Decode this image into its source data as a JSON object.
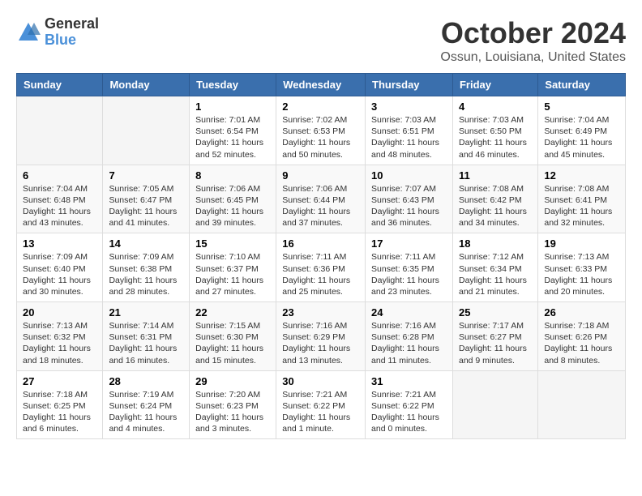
{
  "logo": {
    "general": "General",
    "blue": "Blue"
  },
  "title": "October 2024",
  "location": "Ossun, Louisiana, United States",
  "days_of_week": [
    "Sunday",
    "Monday",
    "Tuesday",
    "Wednesday",
    "Thursday",
    "Friday",
    "Saturday"
  ],
  "weeks": [
    [
      {
        "day": "",
        "info": ""
      },
      {
        "day": "",
        "info": ""
      },
      {
        "day": "1",
        "info": "Sunrise: 7:01 AM\nSunset: 6:54 PM\nDaylight: 11 hours and 52 minutes."
      },
      {
        "day": "2",
        "info": "Sunrise: 7:02 AM\nSunset: 6:53 PM\nDaylight: 11 hours and 50 minutes."
      },
      {
        "day": "3",
        "info": "Sunrise: 7:03 AM\nSunset: 6:51 PM\nDaylight: 11 hours and 48 minutes."
      },
      {
        "day": "4",
        "info": "Sunrise: 7:03 AM\nSunset: 6:50 PM\nDaylight: 11 hours and 46 minutes."
      },
      {
        "day": "5",
        "info": "Sunrise: 7:04 AM\nSunset: 6:49 PM\nDaylight: 11 hours and 45 minutes."
      }
    ],
    [
      {
        "day": "6",
        "info": "Sunrise: 7:04 AM\nSunset: 6:48 PM\nDaylight: 11 hours and 43 minutes."
      },
      {
        "day": "7",
        "info": "Sunrise: 7:05 AM\nSunset: 6:47 PM\nDaylight: 11 hours and 41 minutes."
      },
      {
        "day": "8",
        "info": "Sunrise: 7:06 AM\nSunset: 6:45 PM\nDaylight: 11 hours and 39 minutes."
      },
      {
        "day": "9",
        "info": "Sunrise: 7:06 AM\nSunset: 6:44 PM\nDaylight: 11 hours and 37 minutes."
      },
      {
        "day": "10",
        "info": "Sunrise: 7:07 AM\nSunset: 6:43 PM\nDaylight: 11 hours and 36 minutes."
      },
      {
        "day": "11",
        "info": "Sunrise: 7:08 AM\nSunset: 6:42 PM\nDaylight: 11 hours and 34 minutes."
      },
      {
        "day": "12",
        "info": "Sunrise: 7:08 AM\nSunset: 6:41 PM\nDaylight: 11 hours and 32 minutes."
      }
    ],
    [
      {
        "day": "13",
        "info": "Sunrise: 7:09 AM\nSunset: 6:40 PM\nDaylight: 11 hours and 30 minutes."
      },
      {
        "day": "14",
        "info": "Sunrise: 7:09 AM\nSunset: 6:38 PM\nDaylight: 11 hours and 28 minutes."
      },
      {
        "day": "15",
        "info": "Sunrise: 7:10 AM\nSunset: 6:37 PM\nDaylight: 11 hours and 27 minutes."
      },
      {
        "day": "16",
        "info": "Sunrise: 7:11 AM\nSunset: 6:36 PM\nDaylight: 11 hours and 25 minutes."
      },
      {
        "day": "17",
        "info": "Sunrise: 7:11 AM\nSunset: 6:35 PM\nDaylight: 11 hours and 23 minutes."
      },
      {
        "day": "18",
        "info": "Sunrise: 7:12 AM\nSunset: 6:34 PM\nDaylight: 11 hours and 21 minutes."
      },
      {
        "day": "19",
        "info": "Sunrise: 7:13 AM\nSunset: 6:33 PM\nDaylight: 11 hours and 20 minutes."
      }
    ],
    [
      {
        "day": "20",
        "info": "Sunrise: 7:13 AM\nSunset: 6:32 PM\nDaylight: 11 hours and 18 minutes."
      },
      {
        "day": "21",
        "info": "Sunrise: 7:14 AM\nSunset: 6:31 PM\nDaylight: 11 hours and 16 minutes."
      },
      {
        "day": "22",
        "info": "Sunrise: 7:15 AM\nSunset: 6:30 PM\nDaylight: 11 hours and 15 minutes."
      },
      {
        "day": "23",
        "info": "Sunrise: 7:16 AM\nSunset: 6:29 PM\nDaylight: 11 hours and 13 minutes."
      },
      {
        "day": "24",
        "info": "Sunrise: 7:16 AM\nSunset: 6:28 PM\nDaylight: 11 hours and 11 minutes."
      },
      {
        "day": "25",
        "info": "Sunrise: 7:17 AM\nSunset: 6:27 PM\nDaylight: 11 hours and 9 minutes."
      },
      {
        "day": "26",
        "info": "Sunrise: 7:18 AM\nSunset: 6:26 PM\nDaylight: 11 hours and 8 minutes."
      }
    ],
    [
      {
        "day": "27",
        "info": "Sunrise: 7:18 AM\nSunset: 6:25 PM\nDaylight: 11 hours and 6 minutes."
      },
      {
        "day": "28",
        "info": "Sunrise: 7:19 AM\nSunset: 6:24 PM\nDaylight: 11 hours and 4 minutes."
      },
      {
        "day": "29",
        "info": "Sunrise: 7:20 AM\nSunset: 6:23 PM\nDaylight: 11 hours and 3 minutes."
      },
      {
        "day": "30",
        "info": "Sunrise: 7:21 AM\nSunset: 6:22 PM\nDaylight: 11 hours and 1 minute."
      },
      {
        "day": "31",
        "info": "Sunrise: 7:21 AM\nSunset: 6:22 PM\nDaylight: 11 hours and 0 minutes."
      },
      {
        "day": "",
        "info": ""
      },
      {
        "day": "",
        "info": ""
      }
    ]
  ]
}
